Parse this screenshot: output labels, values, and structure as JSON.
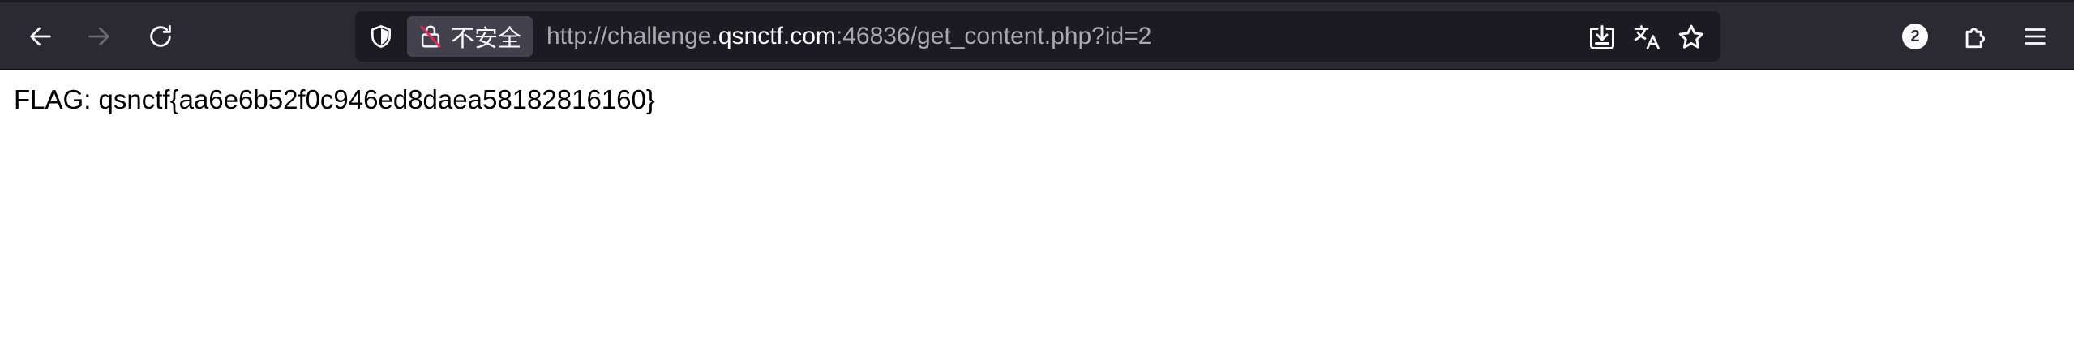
{
  "browser": {
    "url": {
      "prefix": "http://challenge.",
      "host": "qsnctf.com",
      "suffix": ":46836/get_content.php?id=2"
    },
    "security_label": "不安全",
    "extensions_badge_count": "2"
  },
  "icons": {
    "back": "back-arrow-icon",
    "forward": "forward-arrow-icon",
    "reload": "reload-icon",
    "tracking": "shield-icon",
    "insecure": "insecure-lock-icon",
    "download": "download-icon",
    "translate": "translate-icon",
    "bookmark": "star-icon",
    "extensions": "puzzle-icon",
    "menu": "hamburger-menu-icon"
  },
  "colors": {
    "toolbar_bg": "#2b2a33",
    "urlbar_bg": "#1c1b22",
    "chip_bg": "#42414d",
    "text_light": "#fbfbfe",
    "text_dim": "#a9a9ae"
  },
  "page": {
    "body_text": "FLAG: qsnctf{aa6e6b52f0c946ed8daea58182816160}"
  }
}
